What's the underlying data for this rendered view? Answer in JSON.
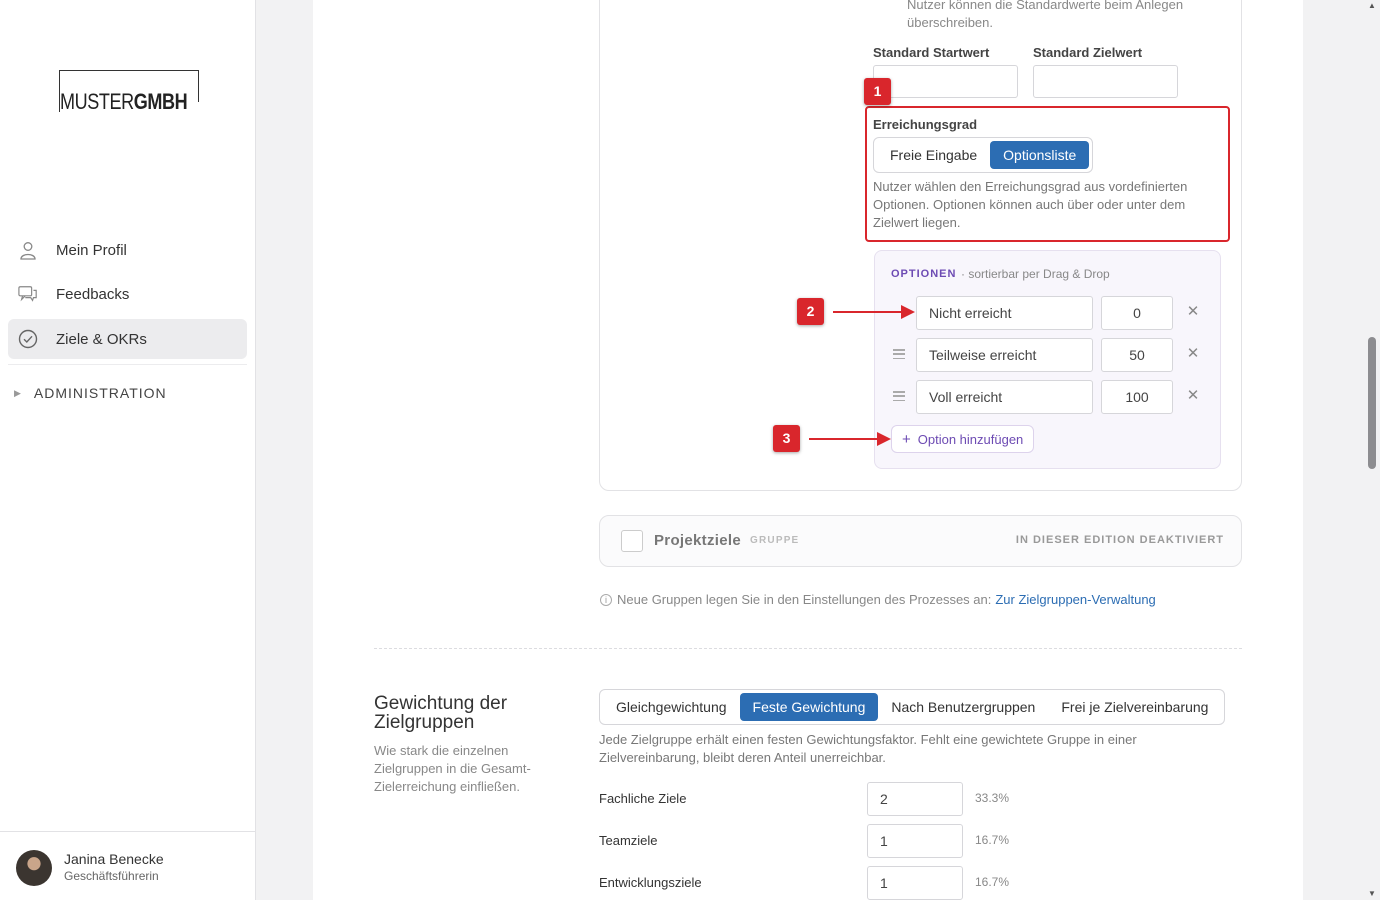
{
  "brand": {
    "logo_thin": "MUSTER",
    "logo_bold": "GMBH"
  },
  "nav": {
    "items": [
      {
        "label": "Mein Profil",
        "icon": "user-icon"
      },
      {
        "label": "Feedbacks",
        "icon": "chat-icon"
      },
      {
        "label": "Ziele & OKRs",
        "icon": "check-circle-icon",
        "active": true
      }
    ],
    "admin_label": "ADMINISTRATION"
  },
  "user": {
    "name": "Janina Benecke",
    "role": "Geschäftsführerin"
  },
  "goal_group": {
    "top_note": "Nutzer können die Standardwerte beim Anlegen überschreiben.",
    "start_label": "Standard Startwert",
    "target_label": "Standard Zielwert",
    "start_value": "",
    "target_value": "",
    "achievement": {
      "label": "Erreichungsgrad",
      "options": [
        "Freie Eingabe",
        "Optionsliste"
      ],
      "selected": "Optionsliste",
      "hint": "Nutzer wählen den Erreichungsgrad aus vordefinierten Optionen. Optionen können auch über oder unter dem Zielwert liegen."
    },
    "options_panel": {
      "header": "OPTIONEN",
      "subheader": "· sortierbar per Drag & Drop",
      "rows": [
        {
          "name": "Nicht erreicht",
          "value": "0"
        },
        {
          "name": "Teilweise erreicht",
          "value": "50"
        },
        {
          "name": "Voll erreicht",
          "value": "100"
        }
      ],
      "add_label": "Option hinzufügen"
    }
  },
  "annotations": {
    "badge1": "1",
    "badge2": "2",
    "badge3": "3",
    "color": "#d9262c"
  },
  "project_group": {
    "title": "Projektziele",
    "tag": "GRUPPE",
    "status": "IN DIESER EDITION DEAKTIVIERT"
  },
  "info": {
    "text": "Neue Gruppen legen Sie in den Einstellungen des Prozesses an:",
    "link": "Zur Zielgruppen-Verwaltung"
  },
  "weighting": {
    "title": "Gewichtung der Zielgruppen",
    "description": "Wie stark die einzelnen Zielgruppen in die Gesamt-Zielerreichung einfließen.",
    "modes": [
      "Gleichgewichtung",
      "Feste Gewichtung",
      "Nach Benutzergruppen",
      "Frei je Zielvereinbarung"
    ],
    "selected": "Feste Gewichtung",
    "hint": "Jede Zielgruppe erhält einen festen Gewichtungsfaktor. Fehlt eine gewichtete Gruppe in einer Zielvereinbarung, bleibt deren Anteil unerreichbar.",
    "rows": [
      {
        "label": "Fachliche Ziele",
        "value": "2",
        "percent": "33.3%"
      },
      {
        "label": "Teamziele",
        "value": "1",
        "percent": "16.7%"
      },
      {
        "label": "Entwicklungsziele",
        "value": "1",
        "percent": "16.7%"
      }
    ]
  },
  "colors": {
    "accent": "#2c6db3",
    "purple": "#6d4bb3"
  }
}
